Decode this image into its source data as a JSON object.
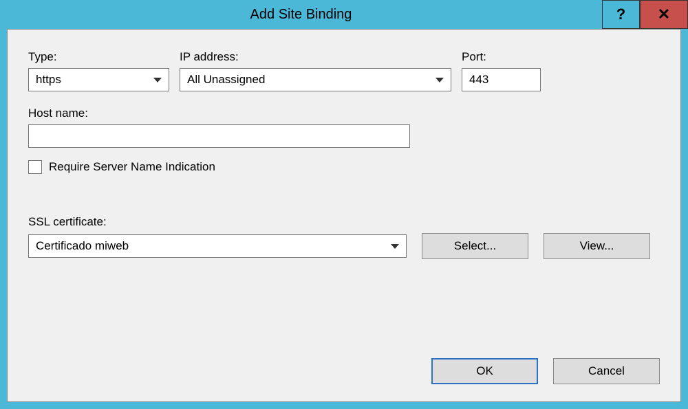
{
  "title": "Add Site Binding",
  "labels": {
    "type": "Type:",
    "ip": "IP address:",
    "port": "Port:",
    "hostname": "Host name:",
    "sni": "Require Server Name Indication",
    "ssl": "SSL certificate:"
  },
  "values": {
    "type": "https",
    "ip": "All Unassigned",
    "port": "443",
    "hostname": "",
    "ssl": "Certificado miweb"
  },
  "buttons": {
    "select": "Select...",
    "view": "View...",
    "ok": "OK",
    "cancel": "Cancel"
  }
}
